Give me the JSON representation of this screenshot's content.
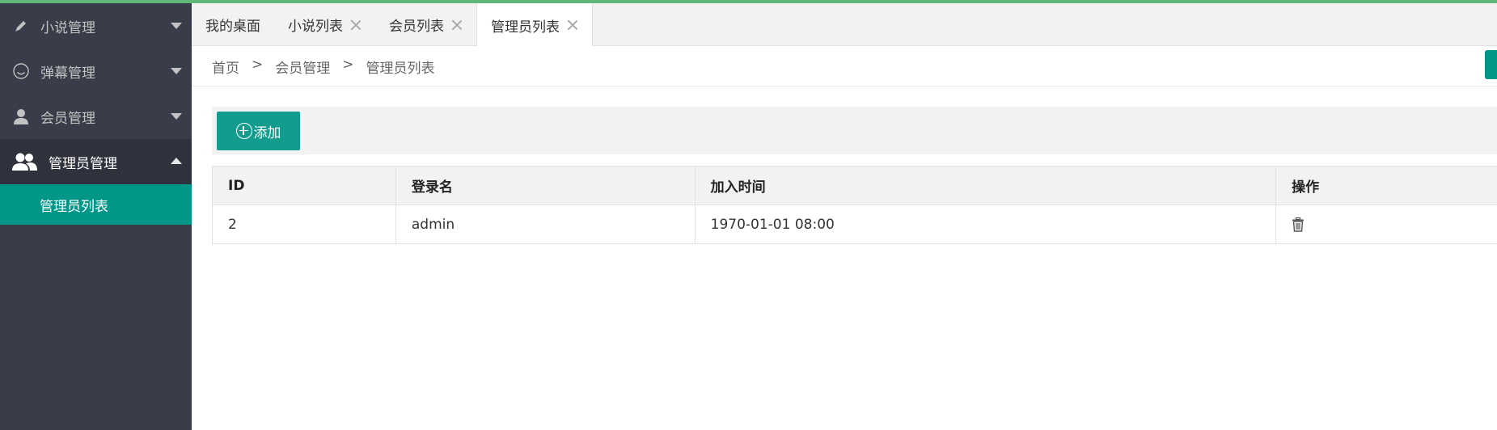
{
  "sidebar": {
    "items": [
      {
        "label": "小说管理",
        "icon": "pencil-icon"
      },
      {
        "label": "弹幕管理",
        "icon": "smile-icon"
      },
      {
        "label": "会员管理",
        "icon": "user-icon"
      },
      {
        "label": "管理员管理",
        "icon": "users-icon",
        "expanded": true,
        "children": [
          {
            "label": "管理员列表",
            "active": true
          }
        ]
      }
    ]
  },
  "tabs": [
    {
      "label": "我的桌面",
      "closable": false
    },
    {
      "label": "小说列表",
      "closable": true
    },
    {
      "label": "会员列表",
      "closable": true
    },
    {
      "label": "管理员列表",
      "closable": true,
      "active": true
    }
  ],
  "breadcrumb": {
    "items": [
      "首页",
      "会员管理",
      "管理员列表"
    ],
    "separator": ">"
  },
  "toolbar": {
    "add_label": "添加"
  },
  "table": {
    "headers": [
      "ID",
      "登录名",
      "加入时间",
      "操作"
    ],
    "rows": [
      {
        "id": "2",
        "name": "admin",
        "joined": "1970-01-01 08:00",
        "action_icon": "trash-icon"
      }
    ]
  },
  "colors": {
    "accent": "#009688",
    "sidebar_bg": "#393d49",
    "top_strip": "#5fb878"
  }
}
